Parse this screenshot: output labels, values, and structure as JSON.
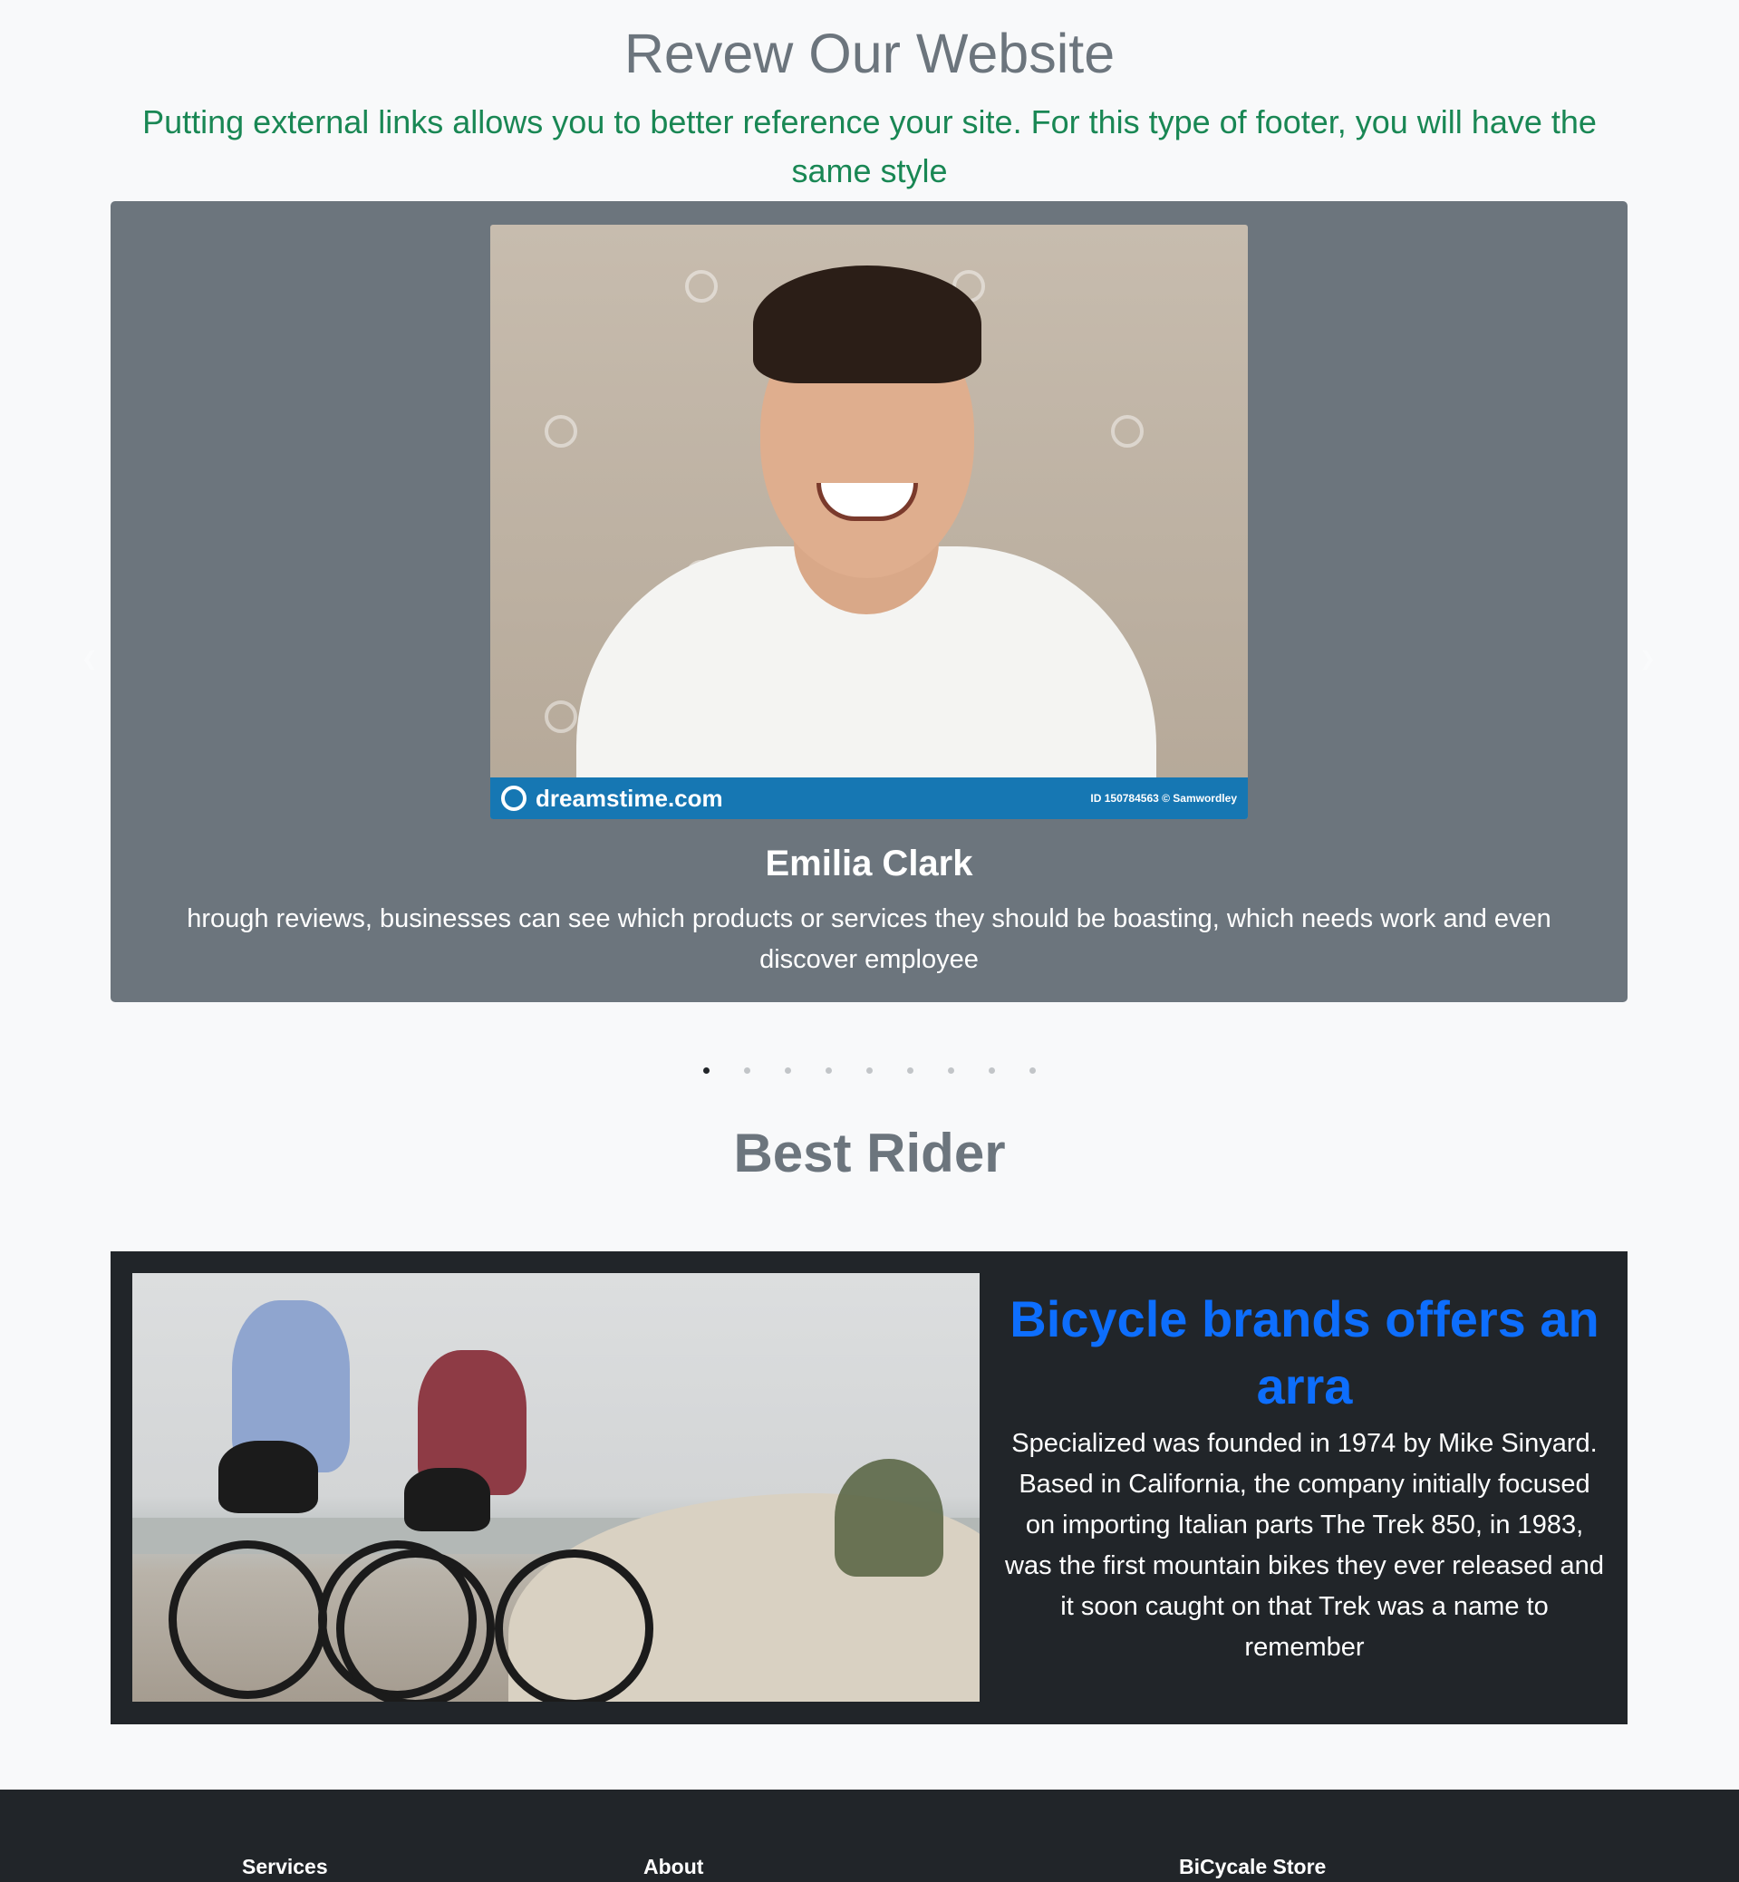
{
  "review": {
    "title": "Revew Our Website",
    "subtitle": "Putting external links allows you to better reference your site. For this type of footer, you will have the same style"
  },
  "carousel": {
    "photo": {
      "brand": "dreamstime.com",
      "id_text": "ID 150784563 © Samwordley"
    },
    "name": "Emilia Clark",
    "text": "hrough reviews, businesses can see which products or services they should be boasting, which needs work and even discover employee",
    "prev_icon": "chevron-left-icon",
    "next_icon": "chevron-right-icon",
    "indicator_count": 9,
    "active_index": 0
  },
  "best_rider": {
    "title": "Best Rider",
    "feature_title": "Bicycle brands offers an arra",
    "feature_text": "Specialized was founded in 1974 by Mike Sinyard. Based in California, the company initially focused on importing Italian parts The Trek 850, in 1983, was the first mountain bikes they ever released and it soon caught on that Trek was a name to remember"
  },
  "footer": {
    "columns": [
      "Services",
      "About",
      "BiCycale Store"
    ]
  },
  "colors": {
    "page_bg": "#f8f9fa",
    "muted": "#6c757d",
    "success": "#198754",
    "primary": "#0d6efd",
    "dark": "#212529"
  }
}
